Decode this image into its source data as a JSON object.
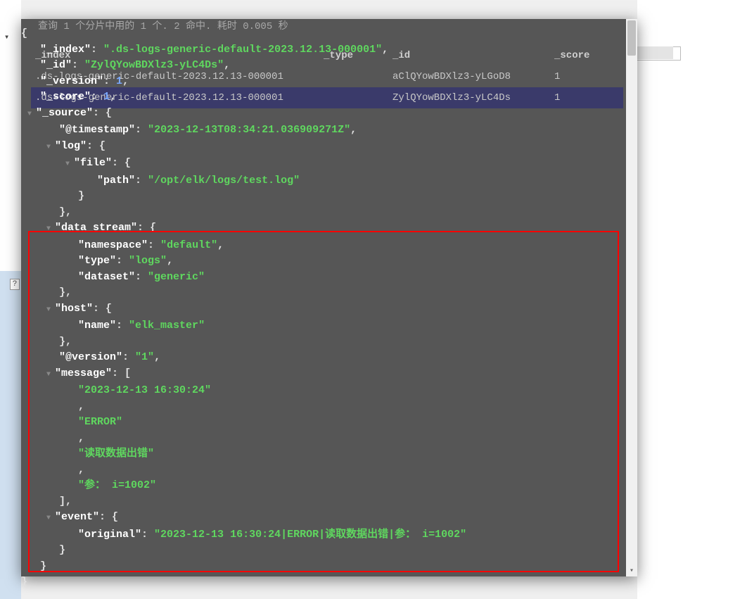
{
  "status_text": "查询 1 个分片中用的 1 个. 2 命中. 耗时 0.005 秒",
  "table": {
    "headers": {
      "index": "_index",
      "type": "_type",
      "id": "_id",
      "score": "_score"
    },
    "rows": [
      {
        "index": ".ds-logs-generic-default-2023.12.13-000001",
        "type": "",
        "id": "aClQYowBDXlz3-yLGoD8",
        "score": "1"
      },
      {
        "index": ".ds-logs-generic-default-2023.12.13-000001",
        "type": "",
        "id": "ZylQYowBDXlz3-yLC4Ds",
        "score": "1"
      }
    ]
  },
  "json": {
    "brace_open": "{",
    "brace_close": "}",
    "index_key": "\"_index\"",
    "index_val": "\".ds-logs-generic-default-2023.12.13-000001\"",
    "id_key": "\"_id\"",
    "id_val": "\"ZylQYowBDXlz3-yLC4Ds\"",
    "version_key": "\"_version\"",
    "version_val": "1",
    "score_key": "\"_score\"",
    "score_val": "1",
    "source_key": "\"_source\"",
    "timestamp_key": "\"@timestamp\"",
    "timestamp_val": "\"2023-12-13T08:34:21.036909271Z\"",
    "log_key": "\"log\"",
    "file_key": "\"file\"",
    "path_key": "\"path\"",
    "path_val": "\"/opt/elk/logs/test.log\"",
    "ds_key": "\"data_stream\"",
    "ns_key": "\"namespace\"",
    "ns_val": "\"default\"",
    "type_key": "\"type\"",
    "type_val": "\"logs\"",
    "dataset_key": "\"dataset\"",
    "dataset_val": "\"generic\"",
    "host_key": "\"host\"",
    "name_key": "\"name\"",
    "name_val": "\"elk_master\"",
    "atversion_key": "\"@version\"",
    "atversion_val": "\"1\"",
    "message_key": "\"message\"",
    "msg0": "\"2023-12-13 16:30:24\"",
    "msg1": "\"ERROR\"",
    "msg2": "\"读取数据出错\"",
    "msg3": "\"参： i=1002\"",
    "event_key": "\"event\"",
    "original_key": "\"original\"",
    "original_val": "\"2023-12-13 16:30:24|ERROR|读取数据出错|参： i=1002\"",
    "comma": ",",
    "colon": ": ",
    "obrace": "{",
    "cbrace": "}",
    "obracket": "[",
    "cbracket": "]"
  },
  "left_badge": "?"
}
